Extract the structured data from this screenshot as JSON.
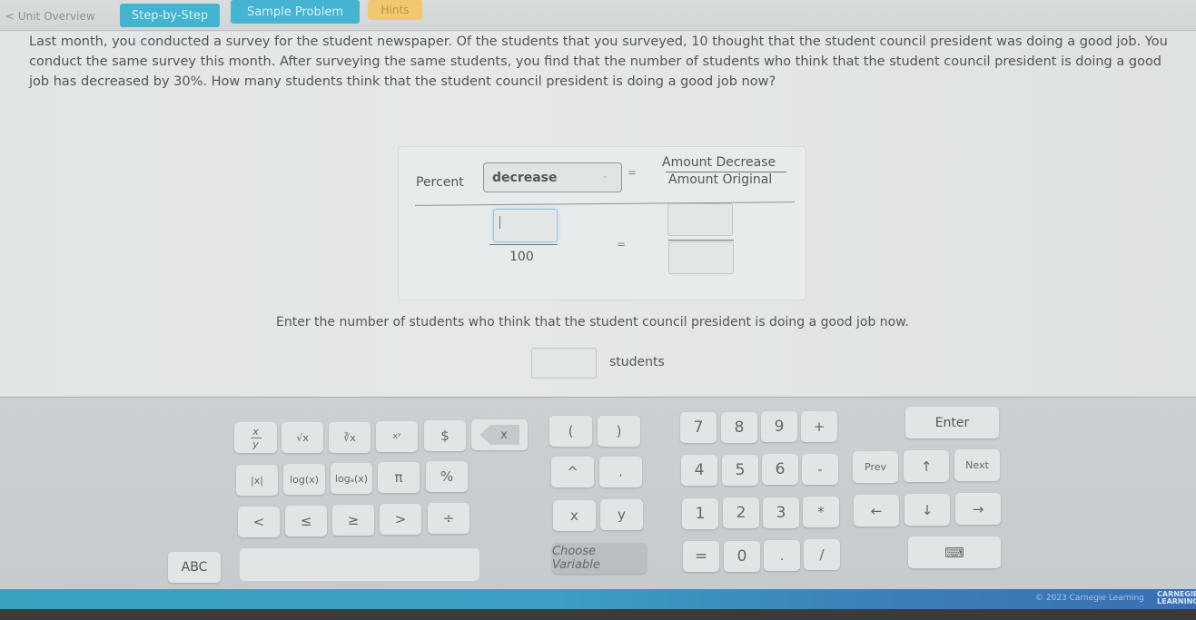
{
  "nav": {
    "back_label": "< Unit Overview",
    "tabs": [
      {
        "label": "Step-by-Step"
      },
      {
        "label": "Sample Problem"
      },
      {
        "label": "Hints"
      }
    ]
  },
  "problem": {
    "lines": [
      "Last month, you conducted a survey for the student newspaper. Of the students that you surveyed, 10 thought that the student council president was doing a good job. You",
      "conduct the same survey this month. After surveying the same students, you find that the number of students who think that the student council president is doing a good",
      "job has decreased by 30%. How many students think that the student council president is doing a good job now?"
    ]
  },
  "equation": {
    "percent_label": "Percent",
    "select_value": "decrease",
    "equals": "=",
    "ratio_numerator": "Amount Decrease",
    "ratio_denominator": "Amount Original",
    "percent_input_value": "",
    "percent_denominator": "100",
    "numerator_input_value": "",
    "denominator_input_value": ""
  },
  "answer": {
    "prompt": "Enter the number of students who think that the student council president is doing a good job now.",
    "input_value": "",
    "unit_label": "students"
  },
  "keypad": {
    "fraction": {
      "top": "x",
      "bottom": "y"
    },
    "sqrt": "√x",
    "nth_root": "∛x",
    "power": "xʸ",
    "dollar": "$",
    "backspace": "x",
    "open_paren": "(",
    "close_paren": ")",
    "abs": "|x|",
    "log": "log(x)",
    "log_base": "logₐ(x)",
    "pi": "π",
    "percent": "%",
    "caret": "^",
    "comma": ",",
    "lt": "<",
    "le": "≤",
    "ge": "≥",
    "gt": ">",
    "divide": "÷",
    "var_x": "x",
    "var_y": "y",
    "choose_variable": "Choose Variable",
    "abc": "ABC",
    "digits": [
      "7",
      "8",
      "9",
      "+",
      "4",
      "5",
      "6",
      "-",
      "1",
      "2",
      "3",
      "*",
      "=",
      "0",
      ".",
      "/"
    ],
    "enter": "Enter",
    "prev": "Prev",
    "next": "Next",
    "up": "↑",
    "left": "←",
    "down": "↓",
    "right": "→",
    "keyboard_toggle": "⌨"
  },
  "footer": {
    "left_text": "",
    "copyright": "© 2023 Carnegie Learning",
    "logo_line1": "CARNEGIE",
    "logo_line2": "LEARNING"
  }
}
